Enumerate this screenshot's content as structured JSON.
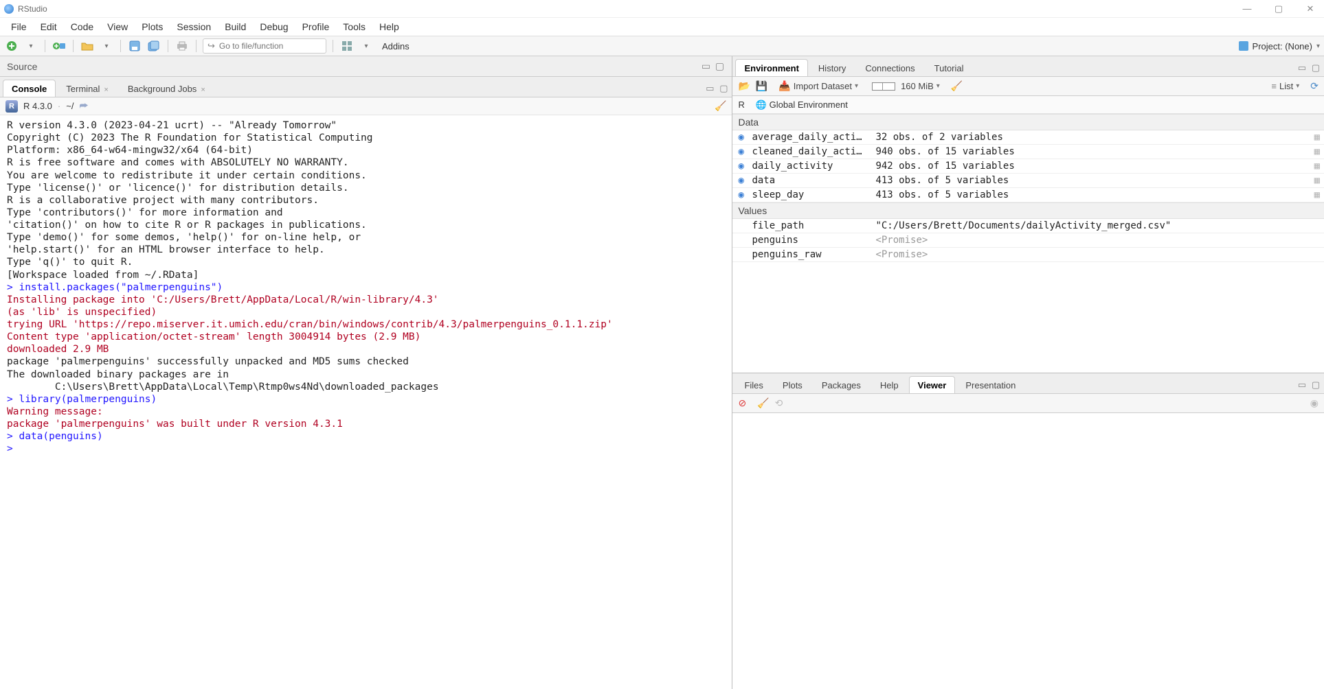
{
  "titlebar": {
    "title": "RStudio"
  },
  "menus": [
    "File",
    "Edit",
    "Code",
    "View",
    "Plots",
    "Session",
    "Build",
    "Debug",
    "Profile",
    "Tools",
    "Help"
  ],
  "toolbar": {
    "goto_placeholder": "Go to file/function",
    "addins_label": "Addins",
    "project_label": "Project: (None)"
  },
  "source_pane": {
    "label": "Source"
  },
  "console_pane": {
    "tabs": [
      {
        "label": "Console",
        "active": true
      },
      {
        "label": "Terminal",
        "closable": true
      },
      {
        "label": "Background Jobs",
        "closable": true
      }
    ],
    "info": {
      "version": "R 4.3.0",
      "path": "~/"
    },
    "lines": [
      {
        "cls": "con-black",
        "text": ""
      },
      {
        "cls": "con-black",
        "text": "R version 4.3.0 (2023-04-21 ucrt) -- \"Already Tomorrow\""
      },
      {
        "cls": "con-black",
        "text": "Copyright (C) 2023 The R Foundation for Statistical Computing"
      },
      {
        "cls": "con-black",
        "text": "Platform: x86_64-w64-mingw32/x64 (64-bit)"
      },
      {
        "cls": "con-black",
        "text": ""
      },
      {
        "cls": "con-black",
        "text": "R is free software and comes with ABSOLUTELY NO WARRANTY."
      },
      {
        "cls": "con-black",
        "text": "You are welcome to redistribute it under certain conditions."
      },
      {
        "cls": "con-black",
        "text": "Type 'license()' or 'licence()' for distribution details."
      },
      {
        "cls": "con-black",
        "text": ""
      },
      {
        "cls": "con-black",
        "text": "R is a collaborative project with many contributors."
      },
      {
        "cls": "con-black",
        "text": "Type 'contributors()' for more information and"
      },
      {
        "cls": "con-black",
        "text": "'citation()' on how to cite R or R packages in publications."
      },
      {
        "cls": "con-black",
        "text": ""
      },
      {
        "cls": "con-black",
        "text": "Type 'demo()' for some demos, 'help()' for on-line help, or"
      },
      {
        "cls": "con-black",
        "text": "'help.start()' for an HTML browser interface to help."
      },
      {
        "cls": "con-black",
        "text": "Type 'q()' to quit R."
      },
      {
        "cls": "con-black",
        "text": ""
      },
      {
        "cls": "con-black",
        "text": "[Workspace loaded from ~/.RData]"
      },
      {
        "cls": "con-black",
        "text": ""
      },
      {
        "cls": "con-blue",
        "text": "> install.packages(\"palmerpenguins\")"
      },
      {
        "cls": "con-red",
        "text": "Installing package into 'C:/Users/Brett/AppData/Local/R/win-library/4.3'"
      },
      {
        "cls": "con-red",
        "text": "(as 'lib' is unspecified)"
      },
      {
        "cls": "con-red",
        "text": "trying URL 'https://repo.miserver.it.umich.edu/cran/bin/windows/contrib/4.3/palmerpenguins_0.1.1.zip'"
      },
      {
        "cls": "con-red",
        "text": "Content type 'application/octet-stream' length 3004914 bytes (2.9 MB)"
      },
      {
        "cls": "con-red",
        "text": "downloaded 2.9 MB"
      },
      {
        "cls": "con-black",
        "text": ""
      },
      {
        "cls": "con-black",
        "text": "package 'palmerpenguins' successfully unpacked and MD5 sums checked"
      },
      {
        "cls": "con-black",
        "text": ""
      },
      {
        "cls": "con-black",
        "text": "The downloaded binary packages are in"
      },
      {
        "cls": "con-black",
        "text": "        C:\\Users\\Brett\\AppData\\Local\\Temp\\Rtmp0ws4Nd\\downloaded_packages"
      },
      {
        "cls": "con-blue",
        "text": "> library(palmerpenguins)"
      },
      {
        "cls": "con-red",
        "text": "Warning message:"
      },
      {
        "cls": "con-red",
        "text": "package 'palmerpenguins' was built under R version 4.3.1 "
      },
      {
        "cls": "con-blue",
        "text": "> data(penguins)"
      },
      {
        "cls": "con-blue",
        "text": "> "
      }
    ]
  },
  "env_pane": {
    "tabs": [
      {
        "label": "Environment",
        "active": true
      },
      {
        "label": "History"
      },
      {
        "label": "Connections"
      },
      {
        "label": "Tutorial"
      }
    ],
    "import_label": "Import Dataset",
    "mem_label": "160 MiB",
    "view_label": "List",
    "scope_btn": "R",
    "scope_label": "Global Environment",
    "sections": [
      {
        "heading": "Data",
        "rows": [
          {
            "bullet": true,
            "name": "average_daily_acti…",
            "desc": "32 obs. of 2 variables",
            "grid": true
          },
          {
            "bullet": true,
            "name": "cleaned_daily_acti…",
            "desc": "940 obs. of 15 variables",
            "grid": true
          },
          {
            "bullet": true,
            "name": "daily_activity",
            "desc": "942 obs. of 15 variables",
            "grid": true
          },
          {
            "bullet": true,
            "name": "data",
            "desc": "413 obs. of 5 variables",
            "grid": true
          },
          {
            "bullet": true,
            "name": "sleep_day",
            "desc": "413 obs. of 5 variables",
            "grid": true
          }
        ]
      },
      {
        "heading": "Values",
        "rows": [
          {
            "bullet": false,
            "name": "file_path",
            "desc": "\"C:/Users/Brett/Documents/dailyActivity_merged.csv\""
          },
          {
            "bullet": false,
            "name": "penguins",
            "desc": "<Promise>",
            "promise": true
          },
          {
            "bullet": false,
            "name": "penguins_raw",
            "desc": "<Promise>",
            "promise": true
          }
        ]
      }
    ]
  },
  "br_pane": {
    "tabs": [
      {
        "label": "Files"
      },
      {
        "label": "Plots"
      },
      {
        "label": "Packages"
      },
      {
        "label": "Help"
      },
      {
        "label": "Viewer",
        "active": true
      },
      {
        "label": "Presentation"
      }
    ]
  }
}
